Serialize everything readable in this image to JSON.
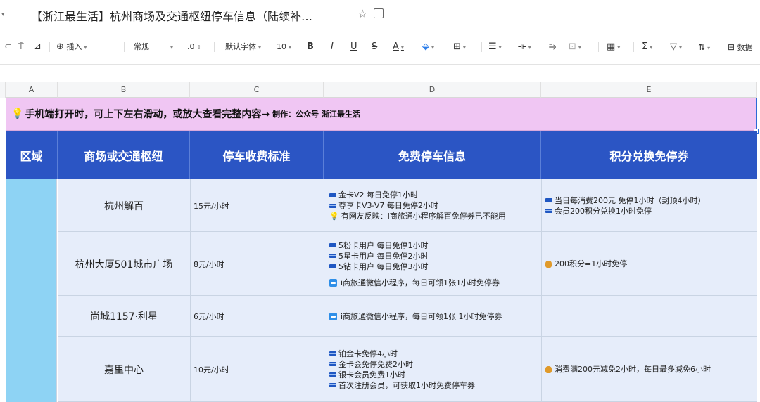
{
  "titlebar": {
    "title": "【浙江最生活】杭州商场及交通枢纽停车信息（陆续补…"
  },
  "toolbar": {
    "insert_label": "插入",
    "format_value": "常规",
    "decimal": ".0",
    "font_value": "默认字体",
    "font_size": "10",
    "bold": "B",
    "italic": "I",
    "underline": "U",
    "strike": "S",
    "font_color": "A",
    "sigma": "Σ",
    "data_label": "数据"
  },
  "columns": [
    "A",
    "B",
    "C",
    "D",
    "E"
  ],
  "banner": {
    "main": "手机端打开时，可上下左右滑动，或放大查看完整内容→",
    "credit": "制作：公众号 浙江最生活"
  },
  "header": {
    "region": "区域",
    "place": "商场或交通枢纽",
    "fee": "停车收费标准",
    "free": "免费停车信息",
    "points": "积分兑换免停券"
  },
  "rows": [
    {
      "name": "杭州解百",
      "fee": "15元/小时",
      "free": [
        {
          "icon": "card",
          "text": "金卡V2 每日免停1小时"
        },
        {
          "icon": "card",
          "text": "尊享卡V3-V7 每日免停2小时"
        },
        {
          "icon": "bulb",
          "text": "有网友反映：i商旅通小程序解百免停券已不能用"
        }
      ],
      "points": [
        {
          "icon": "card",
          "text": "当日每消费200元 免停1小时（封顶4小时）"
        },
        {
          "icon": "card",
          "text": "会员200积分兑换1小时免停"
        }
      ]
    },
    {
      "name": "杭州大厦501城市广场",
      "fee": "8元/小时",
      "free": [
        {
          "icon": "card",
          "text": "5粉卡用户 每日免停1小时"
        },
        {
          "icon": "card",
          "text": "5星卡用户 每日免停2小时"
        },
        {
          "icon": "card",
          "text": "5钻卡用户 每日免停3小时"
        },
        {
          "icon": "blank",
          "text": ""
        },
        {
          "icon": "mini",
          "text": "i商旅通微信小程序，每日可领1张1小时免停券"
        }
      ],
      "points": [
        {
          "icon": "bag",
          "text": "200积分=1小时免停"
        }
      ]
    },
    {
      "name": "尚城1157·利星",
      "fee": "6元/小时",
      "free": [
        {
          "icon": "mini",
          "text": "i商旅通微信小程序，每日可领1张 1小时免停券"
        }
      ],
      "points": []
    },
    {
      "name": "嘉里中心",
      "fee": "10元/小时",
      "free": [
        {
          "icon": "card",
          "text": "铂金卡免停4小时"
        },
        {
          "icon": "card",
          "text": "金卡会免停免费2小时"
        },
        {
          "icon": "card",
          "text": "银卡会员免费1小时"
        },
        {
          "icon": "card",
          "text": "首次注册会员，可获取1小时免费停车券"
        }
      ],
      "points": [
        {
          "icon": "bag",
          "text": "消费满200元减免2小时，每日最多减免6小时"
        }
      ]
    }
  ]
}
